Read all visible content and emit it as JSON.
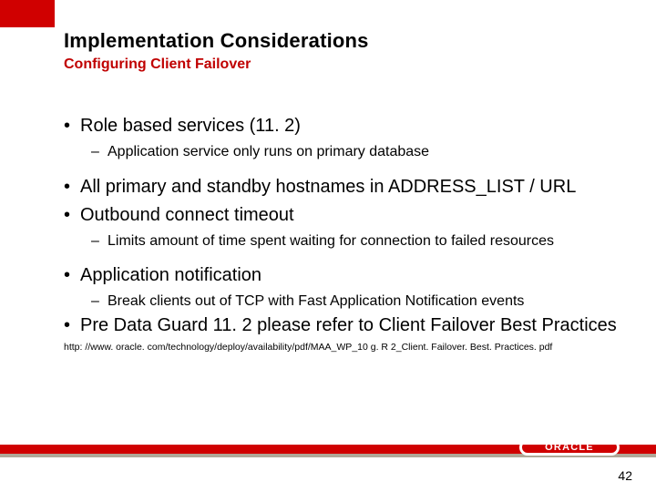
{
  "title": "Implementation Considerations",
  "subtitle": "Configuring Client Failover",
  "bullets": [
    {
      "level": 1,
      "text": "Role based services (11. 2)"
    },
    {
      "level": 2,
      "text": "Application service only runs on primary database"
    },
    {
      "level": 1,
      "text": "All primary and standby hostnames in ADDRESS_LIST / URL"
    },
    {
      "level": 1,
      "text": "Outbound connect timeout"
    },
    {
      "level": 2,
      "text": "Limits amount of time spent waiting for connection to failed resources"
    },
    {
      "level": 1,
      "text": "Application notification"
    },
    {
      "level": 2,
      "text": "Break clients out of TCP with Fast Application Notification events",
      "tight": true
    },
    {
      "level": 1,
      "text": "Pre Data Guard 11. 2 please refer to Client Failover Best Practices"
    }
  ],
  "reference_url": "http: //www. oracle. com/technology/deploy/availability/pdf/MAA_WP_10 g. R 2_Client. Failover. Best. Practices. pdf",
  "logo_text": "ORACLE",
  "logo_reg": "®",
  "page_number": "42"
}
